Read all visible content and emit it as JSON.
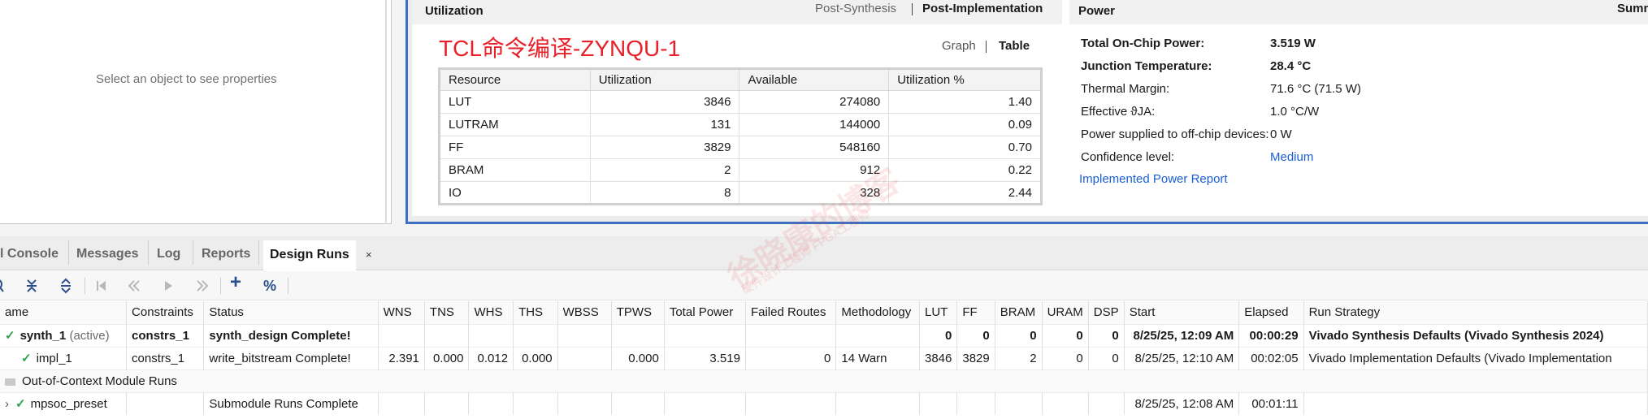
{
  "properties": {
    "empty_text": "Select an object to see properties"
  },
  "utilization": {
    "title": "Utilization",
    "tabs": [
      "Post-Synthesis",
      "Post-Implementation"
    ],
    "heading": "TCL命令编译-ZYNQU-1",
    "views": [
      "Graph",
      "Table"
    ],
    "columns": [
      "Resource",
      "Utilization",
      "Available",
      "Utilization %"
    ],
    "rows": [
      [
        "LUT",
        "3846",
        "274080",
        "1.40"
      ],
      [
        "LUTRAM",
        "131",
        "144000",
        "0.09"
      ],
      [
        "FF",
        "3829",
        "548160",
        "0.70"
      ],
      [
        "BRAM",
        "2",
        "912",
        "0.22"
      ],
      [
        "IO",
        "8",
        "328",
        "2.44"
      ]
    ]
  },
  "power": {
    "title": "Power",
    "summary_tab": "Summ",
    "total_label": "Total On-Chip Power:",
    "total_value": "3.519 W",
    "junction_label": "Junction Temperature:",
    "junction_value": "28.4 °C",
    "thermal_label": "Thermal Margin:",
    "thermal_value": "71.6 °C (71.5 W)",
    "effective_label": "Effective ϑJA:",
    "effective_value": "1.0 °C/W",
    "offchip_label": "Power supplied to off-chip devices:",
    "offchip_value": "0 W",
    "confidence_label": "Confidence level:",
    "confidence_value": "Medium",
    "report_link": "Implemented Power Report"
  },
  "bottom_tabs": {
    "tcl": "l Console",
    "messages": "Messages",
    "log": "Log",
    "reports": "Reports",
    "design_runs": "Design Runs",
    "close": "×"
  },
  "toolbar": {
    "icons": [
      "search-icon",
      "collapse-all-icon",
      "expand-all-icon",
      "first-icon",
      "prev-icon",
      "next-icon",
      "last-icon",
      "add-icon",
      "percent-icon"
    ],
    "percent": "%",
    "add": "+"
  },
  "runs": {
    "columns": [
      "ame",
      "Constraints",
      "Status",
      "WNS",
      "TNS",
      "WHS",
      "THS",
      "WBSS",
      "TPWS",
      "Total Power",
      "Failed Routes",
      "Methodology",
      "LUT",
      "FF",
      "BRAM",
      "URAM",
      "DSP",
      "Start",
      "Elapsed",
      "Run Strategy"
    ],
    "synth": {
      "name": "synth_1",
      "tag": "(active)",
      "constraints": "constrs_1",
      "status": "synth_design Complete!",
      "wns": "",
      "tns": "",
      "whs": "",
      "ths": "",
      "wbss": "",
      "tpws": "",
      "total_power": "",
      "failed_routes": "",
      "methodology": "",
      "lut": "0",
      "ff": "0",
      "bram": "0",
      "uram": "0",
      "dsp": "0",
      "start": "8/25/25, 12:09 AM",
      "elapsed": "00:00:29",
      "strategy": "Vivado Synthesis Defaults (Vivado Synthesis 2024)"
    },
    "impl": {
      "name": "impl_1",
      "constraints": "constrs_1",
      "status": "write_bitstream Complete!",
      "wns": "2.391",
      "tns": "0.000",
      "whs": "0.012",
      "ths": "0.000",
      "wbss": "",
      "tpws": "0.000",
      "total_power": "3.519",
      "failed_routes": "0",
      "methodology": "14 Warn",
      "lut": "3846",
      "ff": "3829",
      "bram": "2",
      "uram": "0",
      "dsp": "0",
      "start": "8/25/25, 12:10 AM",
      "elapsed": "00:02:05",
      "strategy": "Vivado Implementation Defaults (Vivado Implementation"
    },
    "ooc_label": "Out-of-Context Module Runs",
    "mpsoc": {
      "name": "mpsoc_preset",
      "status": "Submodule Runs Complete",
      "start": "8/25/25, 12:08 AM",
      "elapsed": "00:01:11"
    }
  },
  "watermark": {
    "text": "徐晓康的博客",
    "sub": "硬件设计工程师 FPGA工程师"
  }
}
